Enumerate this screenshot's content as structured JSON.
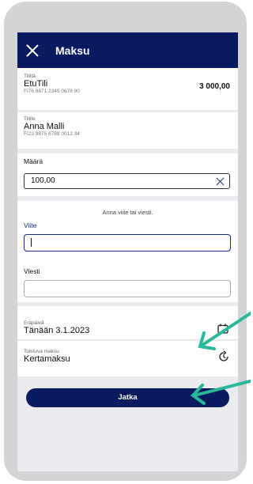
{
  "header": {
    "title": "Maksu"
  },
  "from_account": {
    "label": "Tililtä",
    "name": "EtuTili",
    "iban": "FI76 9871 2345 0678 90",
    "balance": "3 000,00"
  },
  "to_account": {
    "label": "Tilille",
    "name": "Anna Malli",
    "iban": "FI23 9875 6789 0012 34"
  },
  "amount": {
    "label": "Määrä",
    "value": "100,00"
  },
  "reference": {
    "hint": "Anna viite tai viesti.",
    "viite_label": "Viite",
    "viite_value": "",
    "viesti_label": "Viesti",
    "viesti_value": ""
  },
  "due_date": {
    "label": "Eräpäivä",
    "value": "Tänään 3.1.2023"
  },
  "recurring": {
    "label": "Toistuva maksu",
    "value": "Kertamaksu"
  },
  "continue_button": {
    "label": "Jatka"
  },
  "colors": {
    "brand_navy": "#0a1a5e",
    "accent_blue": "#1a2b8a",
    "arrow_teal": "#2bb89a"
  },
  "icons": [
    "close-icon",
    "clear-icon",
    "calendar-icon",
    "recurring-icon",
    "annotation-arrow"
  ]
}
